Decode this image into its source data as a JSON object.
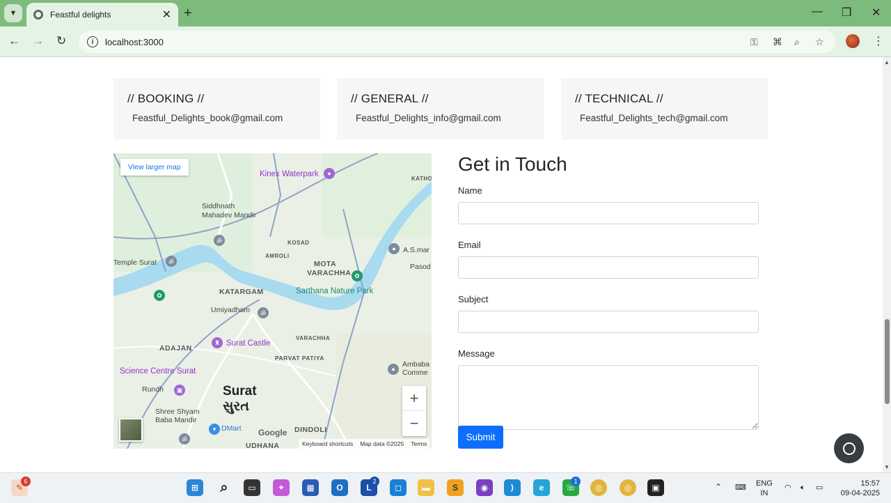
{
  "browser": {
    "tab_title": "Feastful delights",
    "url": "localhost:3000"
  },
  "contact_cards": [
    {
      "heading": "// BOOKING //",
      "email": "Feastful_Delights_book@gmail.com"
    },
    {
      "heading": "// GENERAL //",
      "email": "Feastful_Delights_info@gmail.com"
    },
    {
      "heading": "// TECHNICAL //",
      "email": "Feastful_Delights_tech@gmail.com"
    }
  ],
  "map": {
    "view_larger": "View larger map",
    "zoom_in": "+",
    "zoom_out": "−",
    "footer": {
      "shortcuts": "Keyboard shortcuts",
      "data": "Map data ©2025",
      "terms": "Terms"
    },
    "google": "Google",
    "labels": {
      "kinex": "Kinex Waterpark",
      "siddhnath": "Siddhnath",
      "siddhnath2": "Mahadev Mandir",
      "temple": "Temple Surat",
      "katargam": "KATARGAM",
      "umiyadham": "Umiyadham",
      "mota": "MOTA",
      "varachha": "VARACHHA",
      "sarthana": "Sarthana Nature Park",
      "adajan": "ADAJAN",
      "surat_castle": "Surat Castle",
      "science": "Science Centre Surat",
      "rundh": "Rundh",
      "surat": "Surat",
      "surat_gu": "સુરત",
      "shree": "Shree Shyam",
      "baba": "Baba Mandir",
      "dmart": "DMart",
      "dindoli": "DINDOLI",
      "udhana": "UDHANA",
      "parvat": "PARVAT PATIYA",
      "varachha2": "VARACHHA",
      "asmar": "A.S.mar",
      "pasod": "Pasod",
      "ambaba": "Ambaba",
      "comme": "Comme",
      "kosad": "KOSAD",
      "amroli": "AMROLI",
      "kathor": "KATHO"
    }
  },
  "form": {
    "title": "Get in Touch",
    "name_label": "Name",
    "email_label": "Email",
    "subject_label": "Subject",
    "message_label": "Message",
    "submit_label": "Submit"
  },
  "taskbar": {
    "lang1": "ENG",
    "lang2": "IN",
    "time": "15:57",
    "date": "09-04-2025",
    "badge_notif": "6",
    "badge_l": "2",
    "badge_whatsapp": "1"
  },
  "colors": {
    "chrome_frame": "#7dbb7d",
    "submit_button": "#0d6efd",
    "card_bg": "#f4f6f8"
  }
}
